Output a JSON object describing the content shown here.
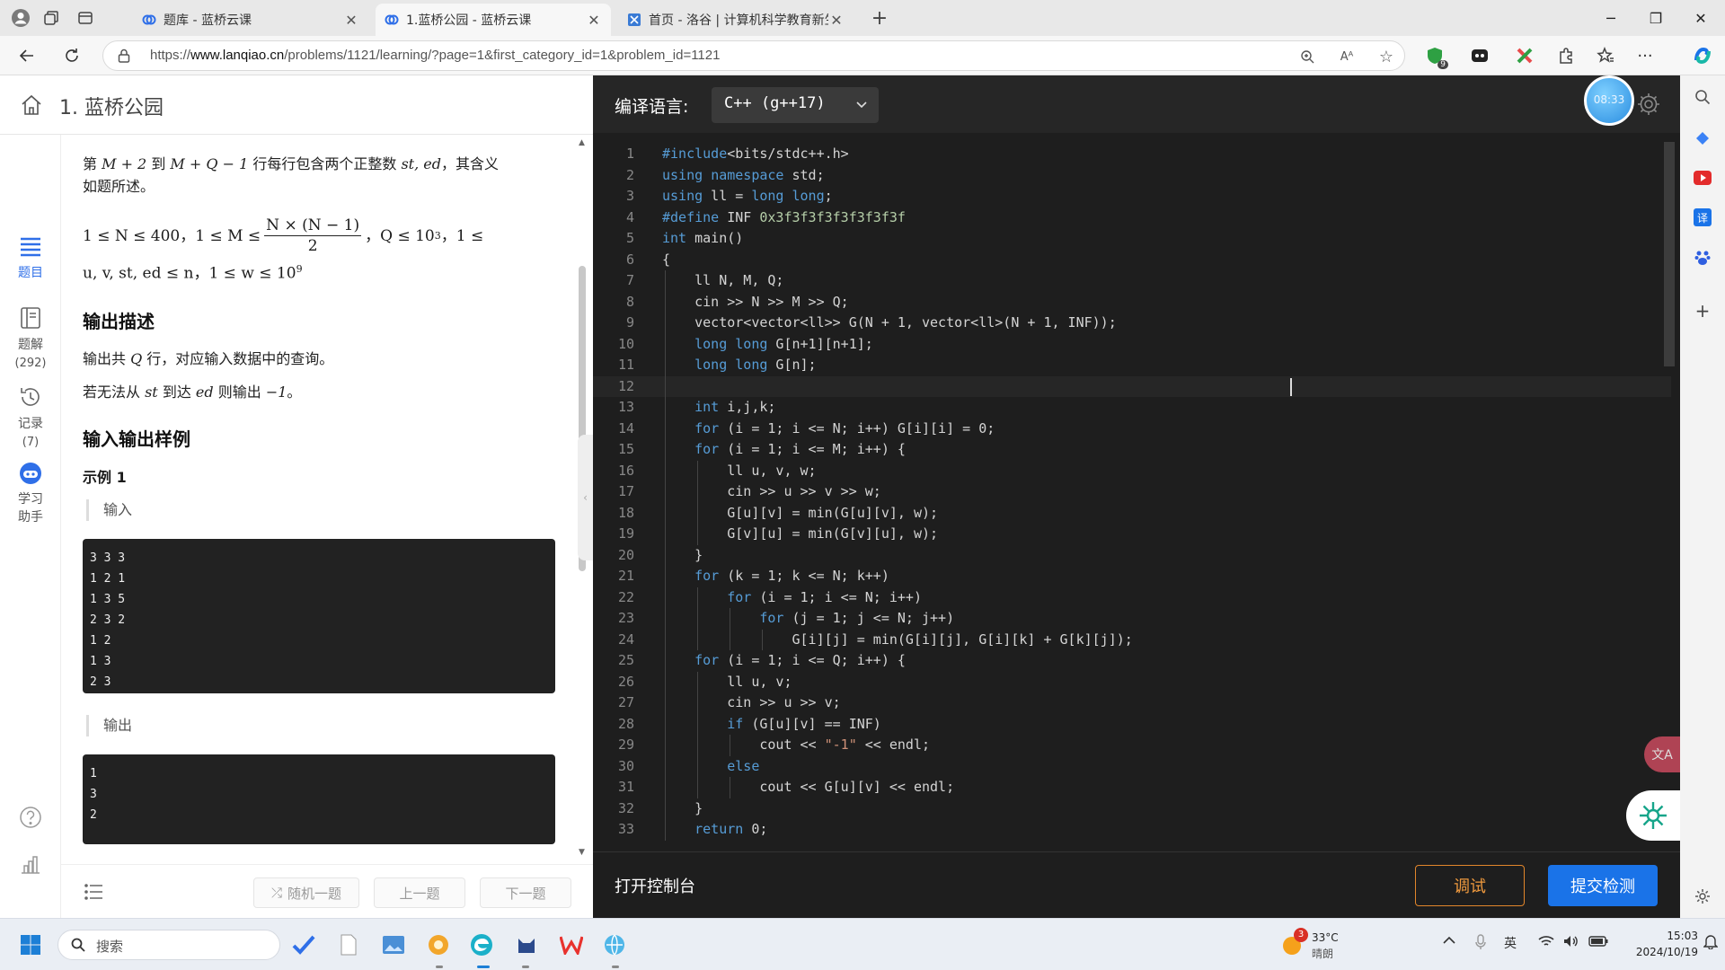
{
  "browser": {
    "tabs": [
      {
        "title": "题库 - 蓝桥云课",
        "active": false
      },
      {
        "title": "1.蓝桥公园 - 蓝桥云课",
        "active": true
      },
      {
        "title": "首页 - 洛谷 | 计算机科学教育新生态",
        "active": false
      }
    ],
    "url_prefix": "https://",
    "url_host": "www.lanqiao.cn",
    "url_path": "/problems/1121/learning/?page=1&first_category_id=1&problem_id=1121",
    "extension_badge": "9"
  },
  "problem": {
    "title": "1. 蓝桥公园",
    "rail": [
      {
        "label": "题目",
        "sub": ""
      },
      {
        "label": "题解",
        "sub": "(292)"
      },
      {
        "label": "记录",
        "sub": "(7)"
      },
      {
        "label": "学习",
        "sub": "助手"
      }
    ],
    "desc_line1_a": "第 ",
    "desc_line1_math1": "M + 2",
    "desc_line1_b": " 到 ",
    "desc_line1_math2": "M + Q − 1",
    "desc_line1_c": " 行每行包含两个正整数 ",
    "desc_line1_math3": "st, ed",
    "desc_line1_d": "，其含义",
    "desc_line2": "如题所述。",
    "constraint_a": "1 ≤ N ≤ 400，1 ≤ M ≤ ",
    "constraint_frac_num": "N × (N − 1)",
    "constraint_frac_den": "2",
    "constraint_b": "，Q ≤ 10",
    "constraint_b_sup": "3",
    "constraint_c": "，1 ≤",
    "constraint_line2": "u, v, st, ed ≤ n，1 ≤ w ≤ 10",
    "constraint_line2_sup": "9",
    "output_heading": "输出描述",
    "output_p1_a": "输出共 ",
    "output_p1_math": "Q",
    "output_p1_b": " 行，对应输入数据中的查询。",
    "output_p2_a": "若无法从 ",
    "output_p2_math1": "st",
    "output_p2_b": " 到达 ",
    "output_p2_math2": "ed",
    "output_p2_c": " 则输出 ",
    "output_p2_math3": "−1",
    "output_p2_d": "。",
    "samples_heading": "输入输出样例",
    "example_title": "示例 1",
    "input_label": "输入",
    "sample_input": "3 3 3\n1 2 1\n1 3 5\n2 3 2\n1 2\n1 3\n2 3",
    "output_label": "输出",
    "sample_output": "1\n3\n2",
    "footer": {
      "random": "随机一题",
      "prev": "上一题",
      "next": "下一题"
    }
  },
  "editor": {
    "lang_label": "编译语言:",
    "lang_value": "C++ (g++17)",
    "timer": "08:33",
    "code_lines": [
      "#include<bits/stdc++.h>",
      "using namespace std;",
      "using ll = long long;",
      "#define INF 0x3f3f3f3f3f3f3f3f",
      "int main()",
      "{",
      "    ll N, M, Q;",
      "    cin >> N >> M >> Q;",
      "    vector<vector<ll>> G(N + 1, vector<ll>(N + 1, INF));",
      "    long long G[n+1][n+1];",
      "    long long G[n];",
      "    ",
      "    int i,j,k;",
      "    for (i = 1; i <= N; i++) G[i][i] = 0;",
      "    for (i = 1; i <= M; i++) {",
      "        ll u, v, w;",
      "        cin >> u >> v >> w;",
      "        G[u][v] = min(G[u][v], w);",
      "        G[v][u] = min(G[v][u], w);",
      "    }",
      "    for (k = 1; k <= N; k++)",
      "        for (i = 1; i <= N; i++)",
      "            for (j = 1; j <= N; j++)",
      "                G[i][j] = min(G[i][j], G[i][k] + G[k][j]);",
      "    for (i = 1; i <= Q; i++) {",
      "        ll u, v;",
      "        cin >> u >> v;",
      "        if (G[u][v] == INF)",
      "            cout << \"-1\" << endl;",
      "        else",
      "            cout << G[u][v] << endl;",
      "    }",
      "    return 0;"
    ],
    "console_label": "打开控制台",
    "debug_label": "调试",
    "submit_label": "提交检测",
    "colors": {
      "keyword": "#569cd6",
      "number": "#b5cea8",
      "string": "#ce9178",
      "text": "#d4d4d4"
    }
  },
  "taskbar": {
    "search_placeholder": "搜索",
    "weather_temp": "33°C",
    "weather_desc": "晴朗",
    "weather_badge": "3",
    "ime": "英",
    "time": "15:03",
    "date": "2024/10/19"
  }
}
